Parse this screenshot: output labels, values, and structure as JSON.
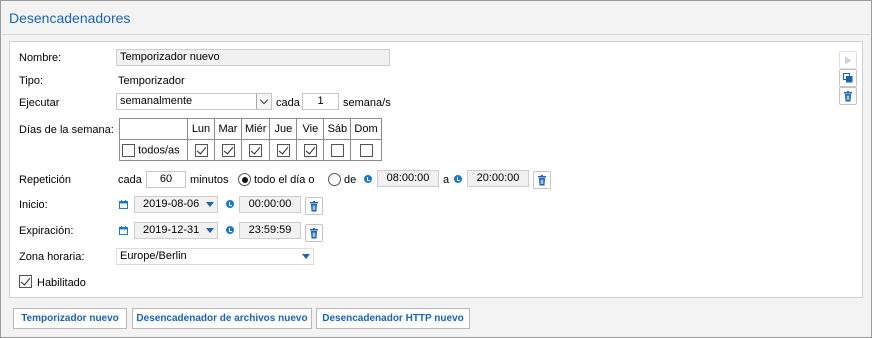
{
  "title": "Desencadenadores",
  "labels": {
    "nombre": "Nombre:",
    "tipo": "Tipo:",
    "ejecutar": "Ejecutar",
    "dias": "Días de la semana:",
    "repeticion": "Repetición",
    "inicio": "Inicio:",
    "expiracion": "Expiración:",
    "zona": "Zona horaria:",
    "habilitado": "Habilitado"
  },
  "nombre_value": "Temporizador nuevo",
  "tipo_value": "Temporizador",
  "ejecutar": {
    "selected": "semanalmente",
    "cada_label": "cada",
    "interval": "1",
    "unit": "semana/s"
  },
  "days": {
    "all_label": "todos/as",
    "headers": [
      "Lun",
      "Mar",
      "Miér",
      "Jue",
      "Vie",
      "Sáb",
      "Dom"
    ],
    "checked": [
      true,
      true,
      true,
      true,
      true,
      false,
      false
    ]
  },
  "repeticion": {
    "cada_label": "cada",
    "value": "60",
    "minutos_label": "minutos",
    "todo_el_dia_label": "todo el día o",
    "de_label": "de",
    "from": "08:00:00",
    "a_label": "a",
    "to": "20:00:00",
    "mode": "todo el día"
  },
  "inicio": {
    "date": "2019-08-06",
    "time": "00:00:00"
  },
  "expiracion": {
    "date": "2019-12-31",
    "time": "23:59:59"
  },
  "zona_value": "Europe/Berlin",
  "habilitado_checked": true,
  "buttons": {
    "temporizador": "Temporizador nuevo",
    "archivos": "Desencadenador de archivos nuevo",
    "http": "Desencadenador HTTP nuevo"
  },
  "icons": [
    "play-icon",
    "duplicate-icon",
    "trash-icon",
    "calendar-icon",
    "clock-icon"
  ],
  "colors": {
    "accent": "#1a63b2",
    "icon_blue": "#1a78c8"
  }
}
